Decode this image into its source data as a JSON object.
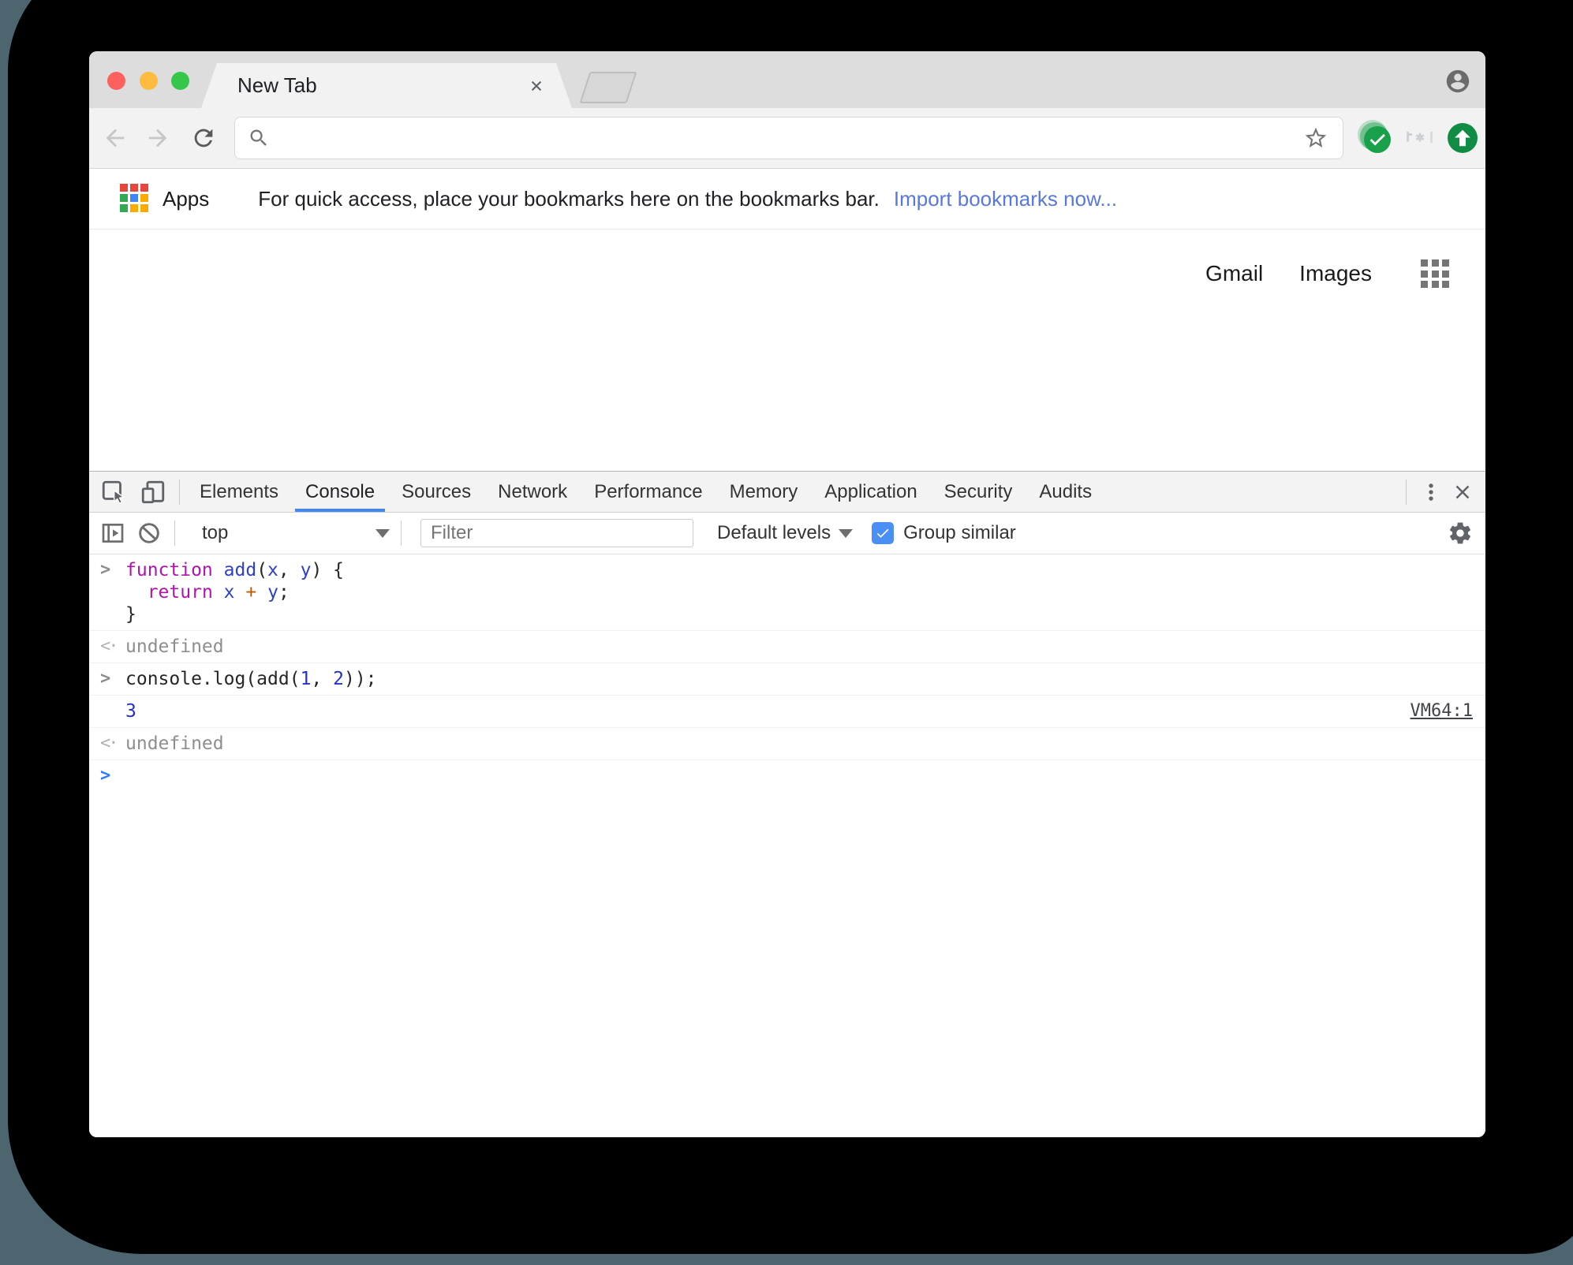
{
  "browser": {
    "tab_title": "New Tab",
    "address_placeholder": "",
    "bookmarks": {
      "apps_label": "Apps",
      "message": "For quick access, place your bookmarks here on the bookmarks bar.",
      "link": "Import bookmarks now...",
      "apps_grid_colors": [
        "#E8453C",
        "#E8453C",
        "#E8453C",
        "#34A853",
        "#4285F4",
        "#F9AB00",
        "#34A853",
        "#F9AB00",
        "#F9AB00"
      ]
    },
    "page": {
      "gmail": "Gmail",
      "images": "Images"
    }
  },
  "devtools": {
    "tabs": [
      "Elements",
      "Console",
      "Sources",
      "Network",
      "Performance",
      "Memory",
      "Application",
      "Security",
      "Audits"
    ],
    "active_tab": "Console",
    "toolbar": {
      "context": "top",
      "filter_placeholder": "Filter",
      "levels_label": "Default levels",
      "group_similar_label": "Group similar",
      "group_similar_checked": true
    },
    "console": {
      "gutter_symbols": {
        "input": ">",
        "result": "<·",
        "log": "",
        "prompt": ">"
      },
      "entries": [
        {
          "kind": "input",
          "lines": [
            [
              {
                "t": "function",
                "c": "kw"
              },
              {
                "t": " "
              },
              {
                "t": "add",
                "c": "var"
              },
              {
                "t": "("
              },
              {
                "t": "x",
                "c": "var"
              },
              {
                "t": ", "
              },
              {
                "t": "y",
                "c": "var"
              },
              {
                "t": ") {"
              }
            ],
            [
              {
                "t": "  "
              },
              {
                "t": "return",
                "c": "kw"
              },
              {
                "t": " "
              },
              {
                "t": "x",
                "c": "var"
              },
              {
                "t": " "
              },
              {
                "t": "+",
                "c": "op"
              },
              {
                "t": " "
              },
              {
                "t": "y",
                "c": "var"
              },
              {
                "t": ";"
              }
            ],
            [
              {
                "t": "}"
              }
            ]
          ]
        },
        {
          "kind": "result",
          "lines": [
            [
              {
                "t": "undefined",
                "c": "undef"
              }
            ]
          ]
        },
        {
          "kind": "input",
          "lines": [
            [
              {
                "t": "console.log(add("
              },
              {
                "t": "1",
                "c": "num"
              },
              {
                "t": ", "
              },
              {
                "t": "2",
                "c": "num"
              },
              {
                "t": "));"
              }
            ]
          ]
        },
        {
          "kind": "log",
          "lines": [
            [
              {
                "t": "3",
                "c": "num"
              }
            ]
          ],
          "link": "VM64:1"
        },
        {
          "kind": "result",
          "lines": [
            [
              {
                "t": "undefined",
                "c": "undef"
              }
            ]
          ]
        },
        {
          "kind": "prompt",
          "lines": []
        }
      ]
    }
  },
  "colors": {
    "accent_blue": "#4285F4",
    "link_blue": "#5878DC",
    "traffic_red": "#FC615D",
    "traffic_yellow": "#FDBC40",
    "traffic_green": "#34C749",
    "extension_green": "#18A04B",
    "keyword": "#B014A8",
    "number_blue": "#2430CD"
  }
}
